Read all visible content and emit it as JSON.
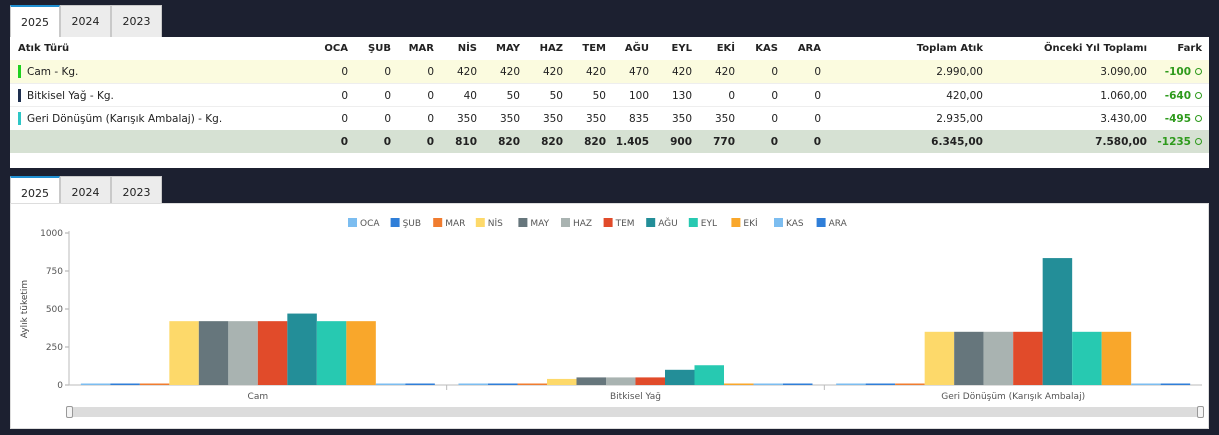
{
  "table": {
    "tabs": [
      "2025",
      "2024",
      "2023"
    ],
    "headers": {
      "name": "Atık Türü",
      "months": [
        "OCA",
        "ŞUB",
        "MAR",
        "NİS",
        "MAY",
        "HAZ",
        "TEM",
        "AĞU",
        "EYL",
        "EKİ",
        "KAS",
        "ARA"
      ],
      "total": "Toplam Atık",
      "prev": "Önceki Yıl Toplamı",
      "diff": "Fark"
    },
    "rows": [
      {
        "name": "Cam - Kg.",
        "color": "#1fd11f",
        "values": [
          "0",
          "0",
          "0",
          "420",
          "420",
          "420",
          "420",
          "470",
          "420",
          "420",
          "0",
          "0"
        ],
        "total": "2.990,00",
        "prev": "3.090,00",
        "diff": "-100"
      },
      {
        "name": "Bitkisel Yağ - Kg.",
        "color": "#1e2f4f",
        "values": [
          "0",
          "0",
          "0",
          "40",
          "50",
          "50",
          "50",
          "100",
          "130",
          "0",
          "0",
          "0"
        ],
        "total": "420,00",
        "prev": "1.060,00",
        "diff": "-640"
      },
      {
        "name": "Geri Dönüşüm (Karışık Ambalaj) - Kg.",
        "color": "#2ec6c6",
        "values": [
          "0",
          "0",
          "0",
          "350",
          "350",
          "350",
          "350",
          "835",
          "350",
          "350",
          "0",
          "0"
        ],
        "total": "2.935,00",
        "prev": "3.430,00",
        "diff": "-495"
      }
    ],
    "totals": {
      "values": [
        "0",
        "0",
        "0",
        "810",
        "820",
        "820",
        "820",
        "1.405",
        "900",
        "770",
        "0",
        "0"
      ],
      "total": "6.345,00",
      "prev": "7.580,00",
      "diff": "-1235"
    }
  },
  "chart_tabs": [
    "2025",
    "2024",
    "2023"
  ],
  "chart_data": {
    "type": "bar",
    "categories": [
      "Cam",
      "Bitkisel Yağ",
      "Geri Dönüşüm (Karışık Ambalaj)"
    ],
    "series": [
      {
        "name": "OCA",
        "color": "#7cbdf0",
        "values": [
          0,
          0,
          0
        ]
      },
      {
        "name": "ŞUB",
        "color": "#2f7ed8",
        "values": [
          0,
          0,
          0
        ]
      },
      {
        "name": "MAR",
        "color": "#f07c2f",
        "values": [
          0,
          0,
          0
        ]
      },
      {
        "name": "NİS",
        "color": "#fdd96a",
        "values": [
          420,
          40,
          350
        ]
      },
      {
        "name": "MAY",
        "color": "#66767c",
        "values": [
          420,
          50,
          350
        ]
      },
      {
        "name": "HAZ",
        "color": "#a9b3b1",
        "values": [
          420,
          50,
          350
        ]
      },
      {
        "name": "TEM",
        "color": "#e14b2a",
        "values": [
          420,
          50,
          350
        ]
      },
      {
        "name": "AĞU",
        "color": "#238e98",
        "values": [
          470,
          100,
          835
        ]
      },
      {
        "name": "EYL",
        "color": "#27c9b1",
        "values": [
          420,
          130,
          350
        ]
      },
      {
        "name": "EKİ",
        "color": "#f9a72b",
        "values": [
          420,
          0,
          350
        ]
      },
      {
        "name": "KAS",
        "color": "#7cbdf0",
        "values": [
          0,
          0,
          0
        ]
      },
      {
        "name": "ARA",
        "color": "#2f7ed8",
        "values": [
          0,
          0,
          0
        ]
      }
    ],
    "ylabel": "Aylık tüketim",
    "yticks": [
      "0",
      "250",
      "500",
      "750",
      "1000"
    ],
    "ylim": [
      0,
      1000
    ],
    "grid": false,
    "legend": "top-center"
  }
}
